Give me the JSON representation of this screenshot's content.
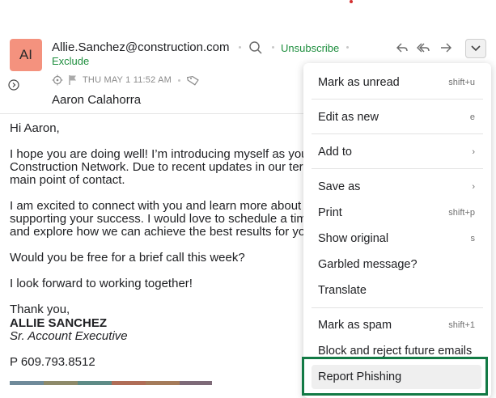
{
  "header": {
    "avatar_initials": "AI",
    "sender_email": "Allie.Sanchez@construction.com",
    "unsubscribe_label": "Unsubscribe",
    "exclude_label": "Exclude",
    "date": "THU MAY 1 11:52 AM",
    "recipient": "Aaron Calahorra"
  },
  "body": {
    "greeting": "Hi Aaron,",
    "para1": "I hope you are doing well! I’m introducing myself as your\nConstruction Network. Due to recent updates in our terri\nmain point of contact.",
    "para2": "I am excited to connect with you and learn more about y\nsupporting your success. I would love to schedule a time\nand explore how we can achieve the best results for you",
    "para3": "Would you be free for a brief call this week?",
    "para4": "I look forward to working together!",
    "closing": "Thank you,",
    "sig_name": "ALLIE SANCHEZ",
    "sig_title": "Sr. Account Executive",
    "sig_phone": "P 609.793.8512"
  },
  "stripe_colors": [
    "#6f8a9a",
    "#8e8a6a",
    "#5e8b86",
    "#b06d57",
    "#a57b5a",
    "#7e6a78"
  ],
  "menu": {
    "items": [
      {
        "label": "Mark as unread",
        "shortcut": "shift+u"
      },
      {
        "label": "Edit as new",
        "shortcut": "e"
      },
      {
        "label": "Add to",
        "shortcut": "›"
      },
      {
        "label": "Save as",
        "shortcut": "›"
      },
      {
        "label": "Print",
        "shortcut": "shift+p"
      },
      {
        "label": "Show original",
        "shortcut": "s"
      },
      {
        "label": "Garbled message?",
        "shortcut": ""
      },
      {
        "label": "Translate",
        "shortcut": ""
      },
      {
        "label": "Mark as spam",
        "shortcut": "shift+1"
      },
      {
        "label": "Block and reject future emails",
        "shortcut": ""
      },
      {
        "label": "Report Phishing",
        "shortcut": ""
      }
    ]
  },
  "icons": {
    "search": "search-icon",
    "reply": "reply-icon",
    "reply_all": "reply-all-icon",
    "forward": "forward-icon",
    "more": "chevron-down-icon"
  }
}
